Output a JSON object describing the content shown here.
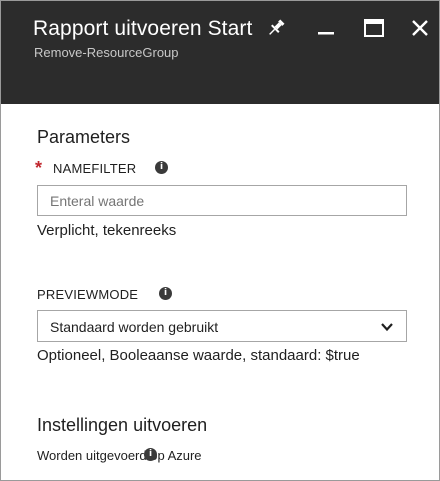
{
  "header": {
    "title": "Rapport uitvoeren Start",
    "subtitle": "Remove-ResourceGroup",
    "pin_icon": "pin-icon",
    "minimize_icon": "minimize-icon",
    "maximize_icon": "maximize-icon",
    "close_icon": "close-icon"
  },
  "parameters": {
    "section_title": "Parameters",
    "namefilter": {
      "required_marker": "*",
      "label": "NAMEFILTER",
      "placeholder": "Enteral waarde",
      "value": "",
      "hint": "Verplicht, tekenreeks"
    },
    "previewmode": {
      "label": "PREVIEWMODE",
      "selected": "Standaard worden gebruikt",
      "hint": "Optioneel, Booleaanse waarde, standaard: $true"
    }
  },
  "run_settings": {
    "section_title": "Instellingen uitvoeren",
    "run_on": "Worden uitgevoerd op Azure"
  },
  "colors": {
    "header_bg": "#2c2c2c",
    "required": "#c0262d"
  }
}
